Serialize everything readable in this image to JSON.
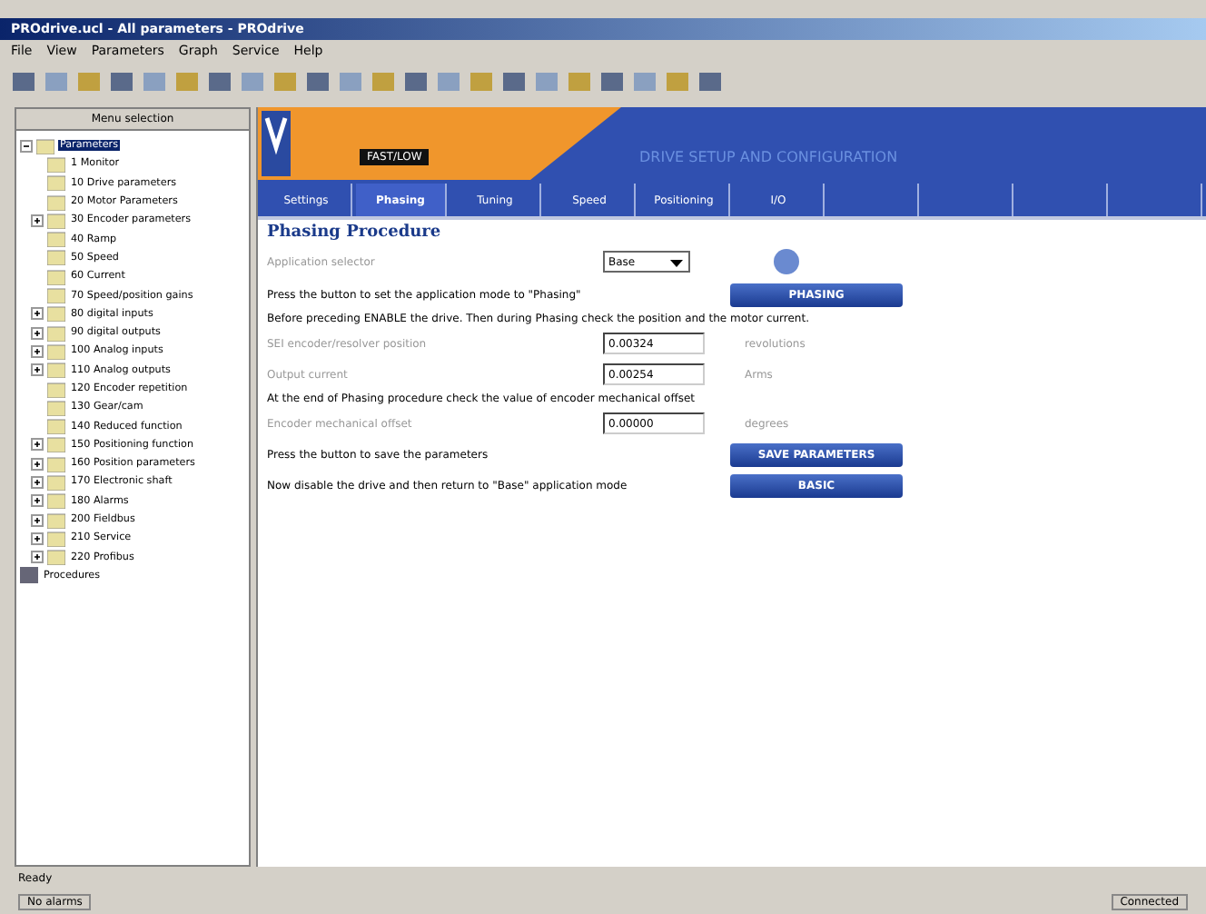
{
  "window": {
    "title": "PROdrive.ucl - All parameters - PROdrive"
  },
  "menu": [
    "File",
    "View",
    "Parameters",
    "Graph",
    "Service",
    "Help"
  ],
  "tree": {
    "header": "Menu selection",
    "root": {
      "label": "Parameters",
      "selected": true,
      "expanded": true,
      "children": [
        {
          "label": "1 Monitor",
          "expandable": false
        },
        {
          "label": "10 Drive parameters",
          "expandable": false
        },
        {
          "label": "20 Motor Parameters",
          "expandable": false
        },
        {
          "label": "30 Encoder parameters",
          "expandable": true
        },
        {
          "label": "40 Ramp",
          "expandable": false
        },
        {
          "label": "50 Speed",
          "expandable": false
        },
        {
          "label": "60 Current",
          "expandable": false
        },
        {
          "label": "70 Speed/position gains",
          "expandable": false
        },
        {
          "label": "80 digital inputs",
          "expandable": true
        },
        {
          "label": "90 digital outputs",
          "expandable": true
        },
        {
          "label": "100 Analog inputs",
          "expandable": true
        },
        {
          "label": "110 Analog outputs",
          "expandable": true
        },
        {
          "label": "120 Encoder repetition",
          "expandable": false
        },
        {
          "label": "130 Gear/cam",
          "expandable": false
        },
        {
          "label": "140 Reduced function",
          "expandable": false
        },
        {
          "label": "150 Positioning function",
          "expandable": true
        },
        {
          "label": "160 Position parameters",
          "expandable": true
        },
        {
          "label": "170 Electronic shaft",
          "expandable": true
        },
        {
          "label": "180 Alarms",
          "expandable": true
        },
        {
          "label": "200 Fieldbus",
          "expandable": true
        },
        {
          "label": "210 Service",
          "expandable": true
        },
        {
          "label": "220 Profibus",
          "expandable": true
        }
      ]
    },
    "other": {
      "label": "Procedures"
    }
  },
  "banner": {
    "badge": "FAST/LOW",
    "title": "DRIVE SETUP AND CONFIGURATION"
  },
  "tabs": [
    {
      "label": "Settings",
      "selected": false
    },
    {
      "label": "Phasing",
      "selected": true
    },
    {
      "label": "Tuning",
      "selected": false
    },
    {
      "label": "Speed",
      "selected": false
    },
    {
      "label": "Positioning",
      "selected": false
    },
    {
      "label": "I/O",
      "selected": false
    }
  ],
  "heading": "Phasing Procedure",
  "rows": [
    {
      "kind": "select",
      "label": "Application selector",
      "value": "Base"
    },
    {
      "kind": "action",
      "text": "Press the button to set the application mode to \"Phasing\"",
      "button": "PHASING"
    },
    {
      "kind": "note",
      "text": "Before preceding ENABLE the drive. Then during Phasing check the position and the motor current."
    },
    {
      "kind": "field",
      "label": "SEI encoder/resolver position",
      "value": "0.00324",
      "unit": "revolutions"
    },
    {
      "kind": "field",
      "label": "Output current",
      "value": "0.00254",
      "unit": "Arms"
    },
    {
      "kind": "note",
      "text": "At the end of Phasing procedure check the value of encoder mechanical offset"
    },
    {
      "kind": "field",
      "label": "Encoder mechanical offset",
      "value": "0.00000",
      "unit": "degrees"
    },
    {
      "kind": "action",
      "text": "Press the button to save the parameters",
      "button": "SAVE PARAMETERS"
    },
    {
      "kind": "action",
      "text": "Now disable the drive and then return to \"Base\" application mode",
      "button": "BASIC"
    }
  ],
  "status": {
    "left": "Ready",
    "panel": "No alarms",
    "right": "Connected"
  }
}
